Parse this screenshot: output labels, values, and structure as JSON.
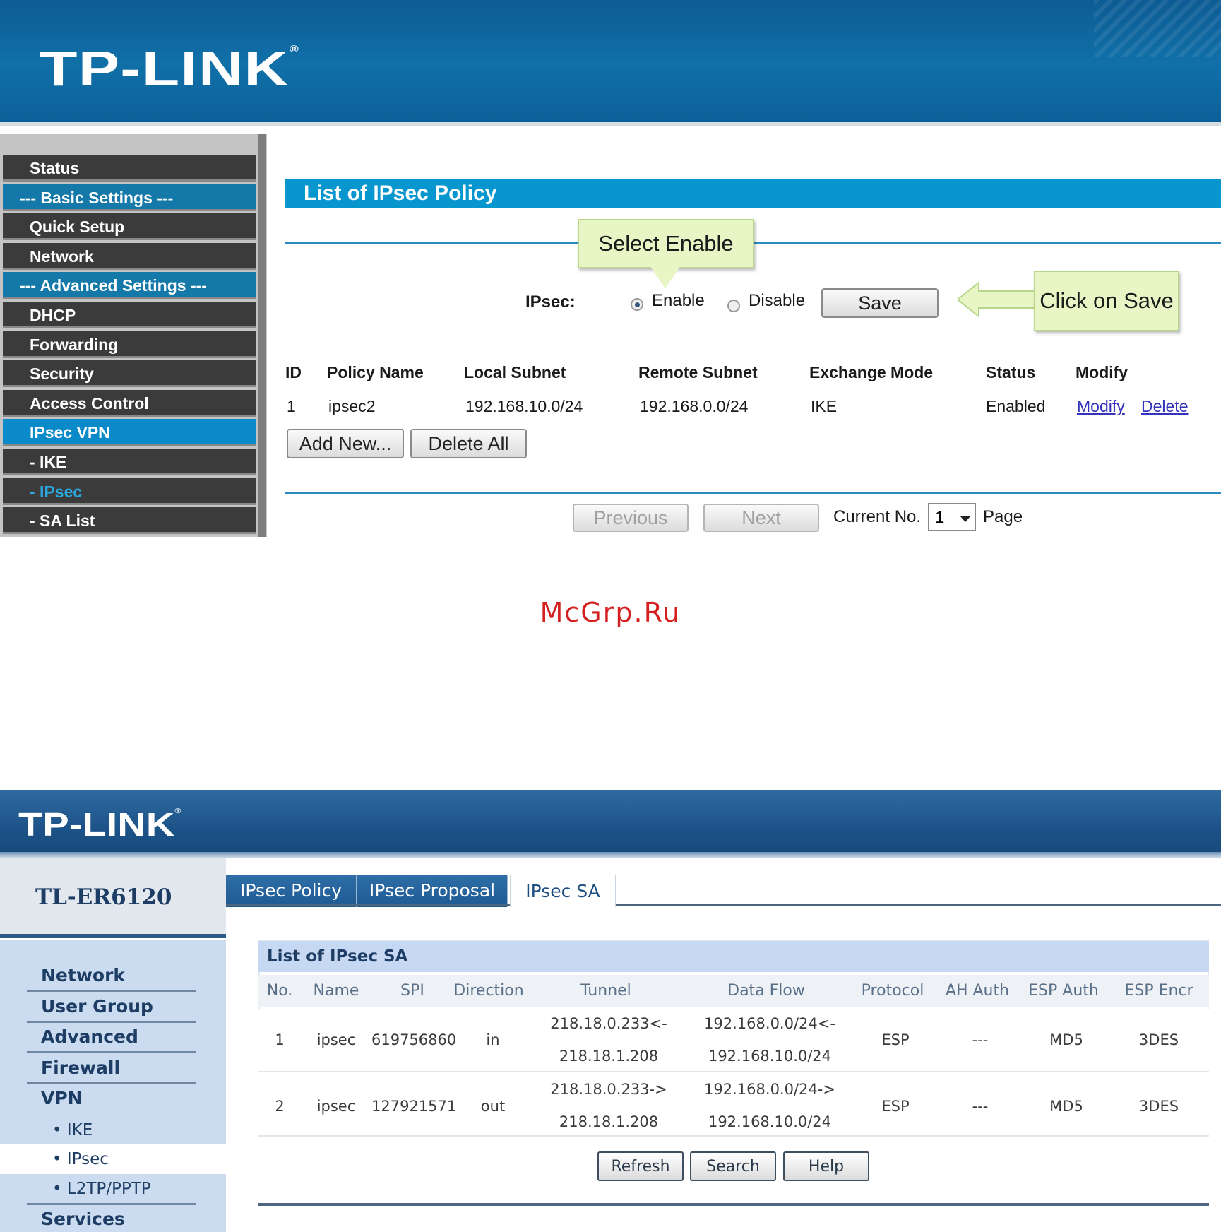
{
  "shot1": {
    "brand": "TP-LINK",
    "sidebar": {
      "items": [
        {
          "label": "Status",
          "kind": "item"
        },
        {
          "label": "--- Basic Settings ---",
          "kind": "section"
        },
        {
          "label": "Quick Setup",
          "kind": "item"
        },
        {
          "label": "Network",
          "kind": "item"
        },
        {
          "label": "--- Advanced Settings ---",
          "kind": "section"
        },
        {
          "label": "DHCP",
          "kind": "item"
        },
        {
          "label": "Forwarding",
          "kind": "item"
        },
        {
          "label": "Security",
          "kind": "item"
        },
        {
          "label": "Access Control",
          "kind": "item"
        },
        {
          "label": "IPsec VPN",
          "kind": "active"
        },
        {
          "label": "- IKE",
          "kind": "item"
        },
        {
          "label": "- IPsec",
          "kind": "current"
        },
        {
          "label": "- SA List",
          "kind": "item"
        }
      ]
    },
    "section_title": "List of IPsec Policy",
    "callout_enable": "Select Enable",
    "callout_save": "Click on Save",
    "ipsec_label": "IPsec:",
    "radio_enable": "Enable",
    "radio_disable": "Disable",
    "selected": "enable",
    "save_label": "Save",
    "table": {
      "headers": [
        "ID",
        "Policy Name",
        "Local Subnet",
        "Remote Subnet",
        "Exchange Mode",
        "Status",
        "Modify"
      ],
      "row": {
        "id": "1",
        "name": "ipsec2",
        "local": "192.168.10.0/24",
        "remote": "192.168.0.0/24",
        "mode": "IKE",
        "status": "Enabled",
        "modify": "Modify",
        "delete": "Delete"
      }
    },
    "add_new_label": "Add New...",
    "delete_all_label": "Delete All",
    "previous_label": "Previous",
    "next_label": "Next",
    "current_no_label": "Current No.",
    "page_value": "1",
    "page_label": "Page"
  },
  "watermark": "McGrp.Ru",
  "shot2": {
    "brand": "TP-LINK",
    "model": "TL-ER6120",
    "nav": [
      "Network",
      "User Group",
      "Advanced",
      "Firewall",
      "VPN"
    ],
    "vpn_sub": [
      "• IKE",
      "• IPsec",
      "• L2TP/PPTP"
    ],
    "nav_services": "Services",
    "tabs": [
      "IPsec Policy",
      "IPsec Proposal",
      "IPsec SA"
    ],
    "active_tab": "IPsec SA",
    "list_title": "List of IPsec SA",
    "headers": [
      "No.",
      "Name",
      "SPI",
      "Direction",
      "Tunnel",
      "Data Flow",
      "Protocol",
      "AH Auth",
      "ESP Auth",
      "ESP Encr"
    ],
    "rows": [
      {
        "no": "1",
        "name": "ipsec",
        "spi": "619756860",
        "direction": "in",
        "tunnel_a": "218.18.0.233<-",
        "tunnel_b": "218.18.1.208",
        "flow_a": "192.168.0.0/24<-",
        "flow_b": "192.168.10.0/24",
        "protocol": "ESP",
        "ah": "---",
        "esp_auth": "MD5",
        "esp_encr": "3DES"
      },
      {
        "no": "2",
        "name": "ipsec",
        "spi": "127921571",
        "direction": "out",
        "tunnel_a": "218.18.0.233->",
        "tunnel_b": "218.18.1.208",
        "flow_a": "192.168.0.0/24->",
        "flow_b": "192.168.10.0/24",
        "protocol": "ESP",
        "ah": "---",
        "esp_auth": "MD5",
        "esp_encr": "3DES"
      }
    ],
    "refresh_label": "Refresh",
    "search_label": "Search",
    "help_label": "Help"
  }
}
